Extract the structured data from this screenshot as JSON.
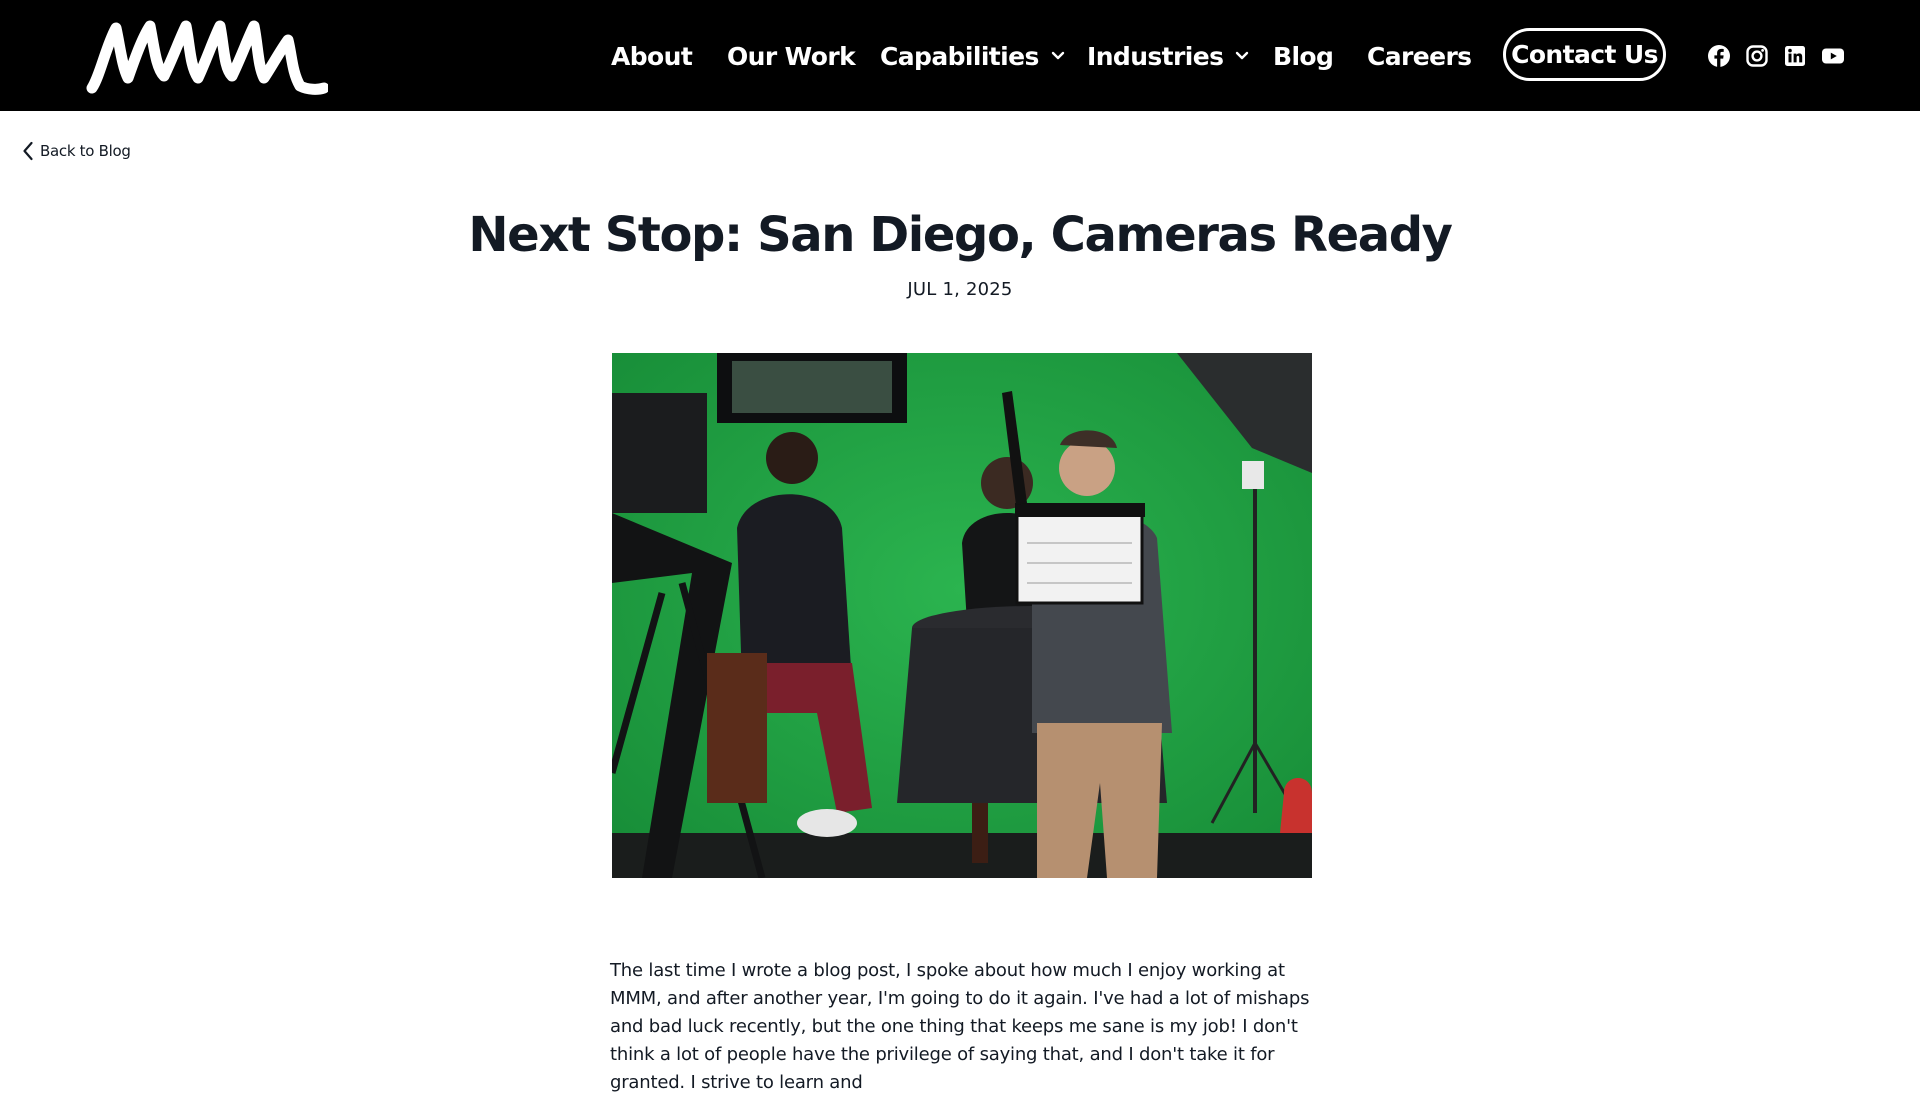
{
  "header": {
    "logo_text": "MMM",
    "nav": [
      {
        "label": "About",
        "dropdown": false
      },
      {
        "label": "Our Work",
        "dropdown": false
      },
      {
        "label": "Capabilities",
        "dropdown": true
      },
      {
        "label": "Industries",
        "dropdown": true
      },
      {
        "label": "Blog",
        "dropdown": false
      },
      {
        "label": "Careers",
        "dropdown": false
      }
    ],
    "contact_label": "Contact Us",
    "social_icons": [
      "facebook-icon",
      "instagram-icon",
      "linkedin-icon",
      "youtube-icon"
    ],
    "colors": {
      "background": "#000000",
      "text": "#ffffff"
    }
  },
  "back_link": {
    "label": "Back to Blog"
  },
  "post": {
    "title": "Next Stop: San Diego, Cameras Ready",
    "date": "JUL 1, 2025",
    "hero_image": "photo of a film crew on a green screen set with a clapperboard",
    "body": "The last time I wrote a blog post, I spoke about how much I enjoy working at MMM, and after another year, I'm going to do it again. I've had a lot of mishaps and bad luck recently, but the one thing that keeps me sane is my job! I don't think a lot of people have the privilege of saying that, and I don't take it for granted. I strive to learn and"
  },
  "colors": {
    "text": "#131a24",
    "green_screen": "#1fa046"
  }
}
